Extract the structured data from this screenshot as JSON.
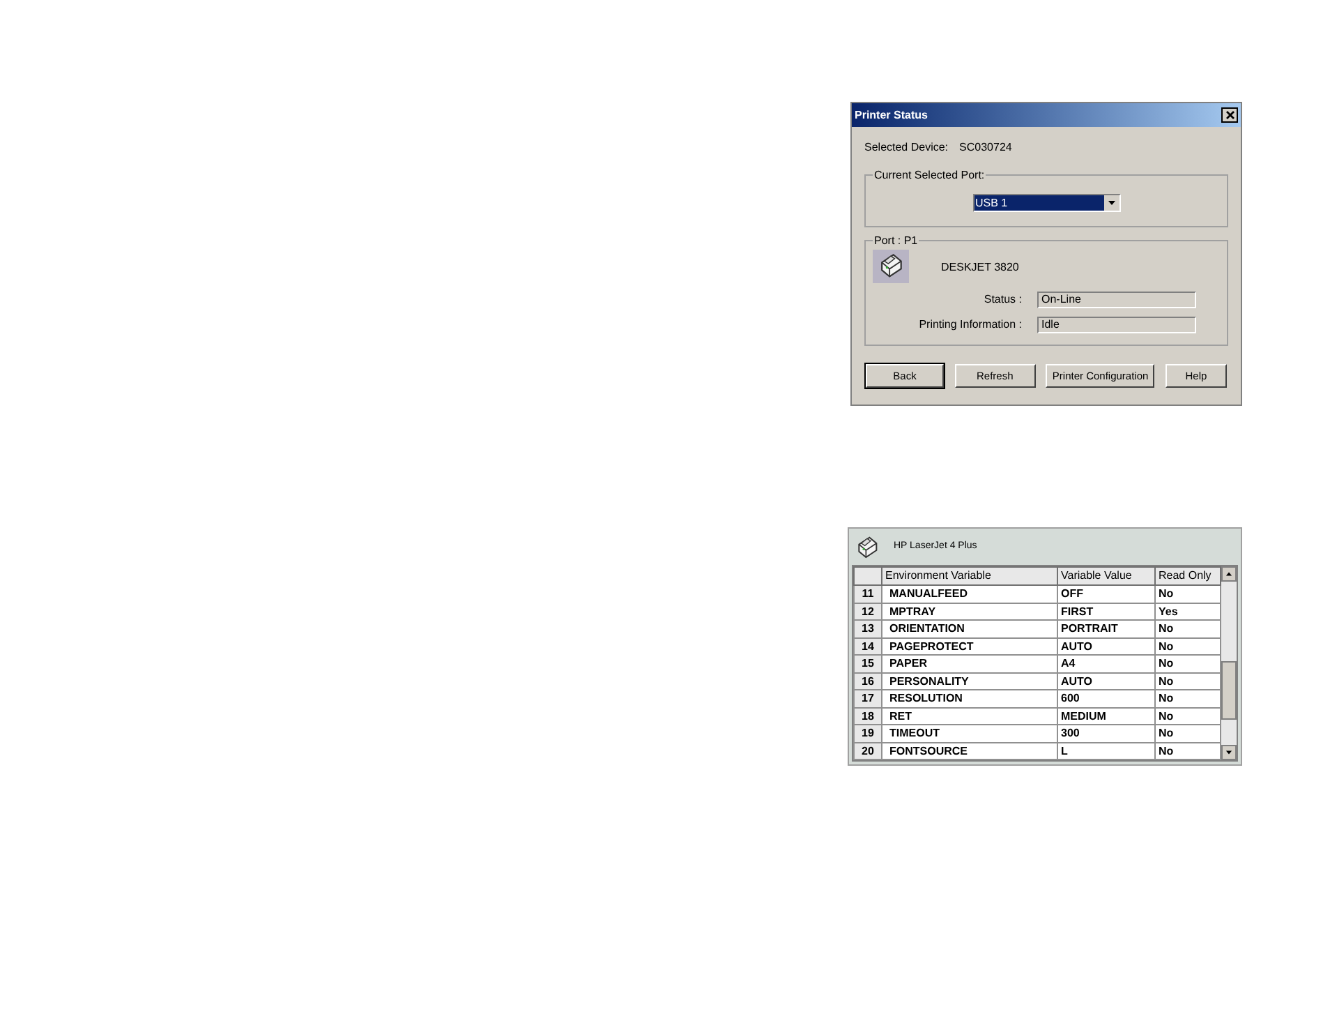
{
  "printer_status_dialog": {
    "title": "Printer Status",
    "selected_device_label": "Selected Device:",
    "selected_device": "SC030724",
    "port_group": {
      "legend": "Current Selected Port:",
      "value": "USB 1"
    },
    "port_info": {
      "legend": "Port : P1",
      "printer_name": "DESKJET 3820",
      "fields": [
        {
          "label": "Status :",
          "value": "On-Line"
        },
        {
          "label": "Printing Information :",
          "value": "Idle"
        }
      ]
    },
    "buttons": [
      "Back",
      "Refresh",
      "Printer Configuration",
      "Help"
    ]
  },
  "variables_panel": {
    "printer_name": "HP LaserJet 4 Plus",
    "columns": [
      "",
      "Environment Variable",
      "Variable Value",
      "Read Only"
    ],
    "rows": [
      [
        "11",
        "MANUALFEED",
        "OFF",
        "No"
      ],
      [
        "12",
        "MPTRAY",
        "FIRST",
        "Yes"
      ],
      [
        "13",
        "ORIENTATION",
        "PORTRAIT",
        "No"
      ],
      [
        "14",
        "PAGEPROTECT",
        "AUTO",
        "No"
      ],
      [
        "15",
        "PAPER",
        "A4",
        "No"
      ],
      [
        "16",
        "PERSONALITY",
        "AUTO",
        "No"
      ],
      [
        "17",
        "RESOLUTION",
        "600",
        "No"
      ],
      [
        "18",
        "RET",
        "MEDIUM",
        "No"
      ],
      [
        "19",
        "TIMEOUT",
        "300",
        "No"
      ],
      [
        "20",
        "FONTSOURCE",
        "L",
        "No"
      ]
    ]
  }
}
